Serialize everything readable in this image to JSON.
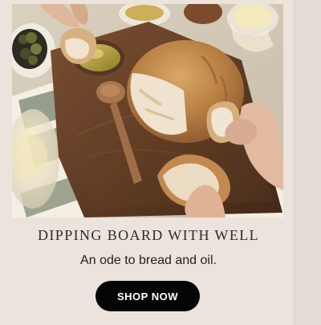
{
  "hero": {
    "colors": {
      "background": "#d8cfbf",
      "board": "#6c4328",
      "crust": "#b98145",
      "crumb": "#efe3cf",
      "cloth": "#f4efe5",
      "stripe": "#8b9482",
      "oil": "#b7a13f"
    }
  },
  "product": {
    "title": "DIPPING BOARD WITH WELL",
    "tagline": "An ode to bread and oil."
  },
  "cta": {
    "label": "SHOP NOW",
    "background": "#050505",
    "text_color": "#ffffff"
  }
}
